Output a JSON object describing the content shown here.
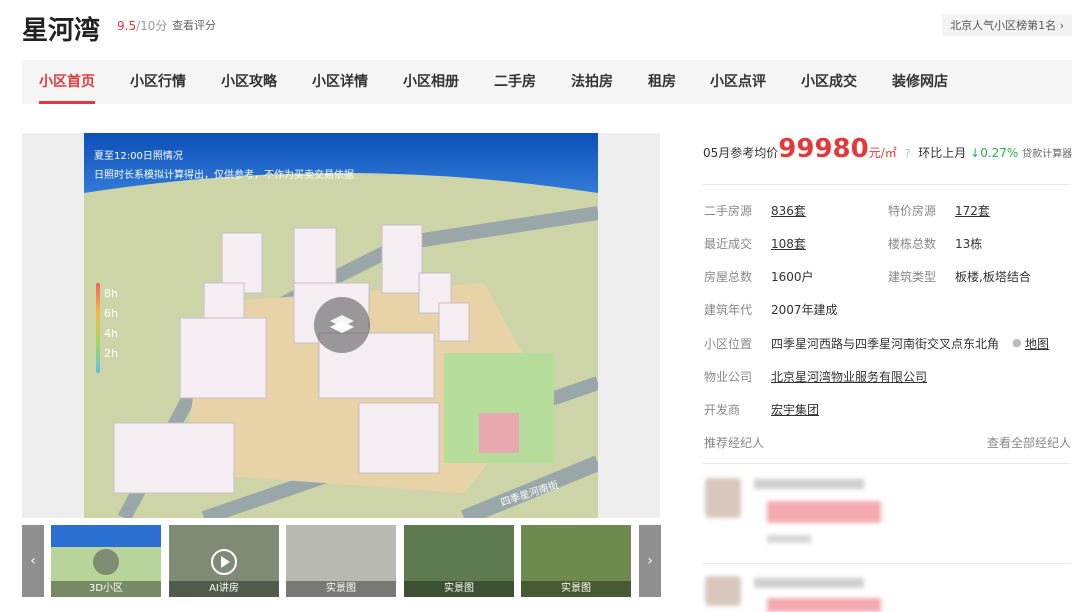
{
  "header": {
    "title": "星河湾",
    "score": "9.5",
    "score_unit": "/10分",
    "review_link": "查看评分",
    "rank_badge": "北京人气小区榜第1名 ›"
  },
  "nav": {
    "items": [
      "小区首页",
      "小区行情",
      "小区攻略",
      "小区详情",
      "小区相册",
      "二手房",
      "法拍房",
      "租房",
      "小区点评",
      "小区成交",
      "装修网店"
    ],
    "active": "小区首页"
  },
  "viewer": {
    "overlay_line1": "夏至12:00日照情况",
    "overlay_line2": "日照时长系模拟计算得出，仅供参考，不作为买卖交易依据",
    "legend": [
      "8h",
      "6h",
      "4h",
      "2h"
    ],
    "road_label": "四季星河南街",
    "thumbnails": [
      {
        "caption": "3D小区"
      },
      {
        "caption": "AI讲房"
      },
      {
        "caption": "实景图"
      },
      {
        "caption": "实景图"
      },
      {
        "caption": "实景图"
      }
    ],
    "prev_arrow": "‹",
    "next_arrow": "›"
  },
  "price": {
    "label": "05月参考均价",
    "value": "99980",
    "unit": "元/㎡",
    "help": "?",
    "mom_label": "环比上月",
    "mom_value": "↓0.27%",
    "calculator": "贷款计算器"
  },
  "info": {
    "secondhand_label": "二手房源",
    "secondhand_value": "836套",
    "special_label": "特价房源",
    "special_value": "172套",
    "recent_label": "最近成交",
    "recent_value": "108套",
    "buildings_label": "楼栋总数",
    "buildings_value": "13栋",
    "houses_label": "房屋总数",
    "houses_value": "1600户",
    "type_label": "建筑类型",
    "type_value": "板楼,板塔结合",
    "year_label": "建筑年代",
    "year_value": "2007年建成",
    "location_label": "小区位置",
    "location_value": "四季星河西路与四季星河南街交叉点东北角",
    "map_link": "地图",
    "property_label": "物业公司",
    "property_value": "北京星河湾物业服务有限公司",
    "developer_label": "开发商",
    "developer_value": "宏宇集团",
    "agents_label": "推荐经纪人",
    "agents_all": "查看全部经纪人"
  },
  "colors": {
    "accent": "#e4393c",
    "down": "#2bb24c"
  }
}
